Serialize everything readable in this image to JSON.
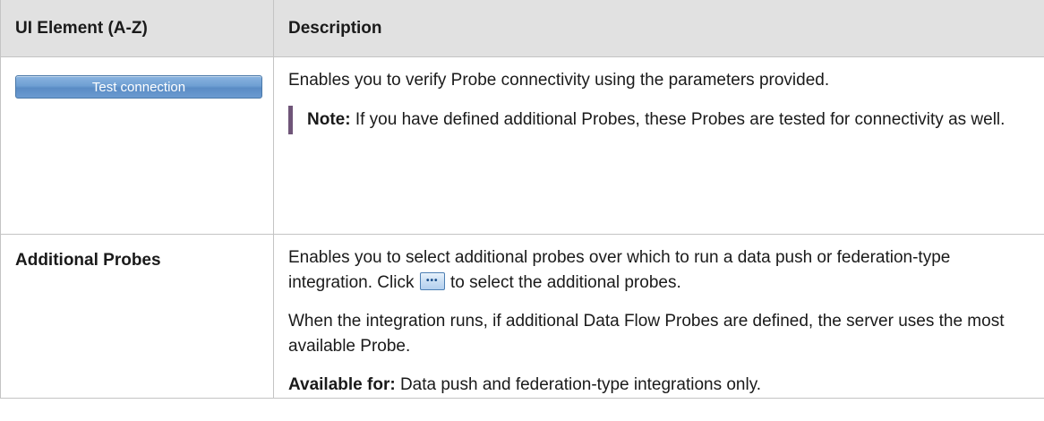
{
  "table": {
    "headers": {
      "element": "UI Element (A-Z)",
      "description": "Description"
    },
    "rows": [
      {
        "button_label": "Test connection",
        "description": "Enables you to verify Probe connectivity using the parameters provided.",
        "note_label": "Note:",
        "note_text": "If you have defined additional Probes, these Probes are tested for connectivity as well."
      },
      {
        "label": "Additional Probes",
        "desc_part1": "Enables you to select additional probes over which to run a data push or federation-type integration. Click",
        "button_icon": "ellipsis-icon",
        "desc_part2": "to select the additional probes.",
        "paragraph2": "When the integration runs, if additional Data Flow Probes are defined, the server uses the most available Probe.",
        "avail_label": "Available for:",
        "avail_text": "Data push and federation-type integrations only."
      }
    ]
  }
}
